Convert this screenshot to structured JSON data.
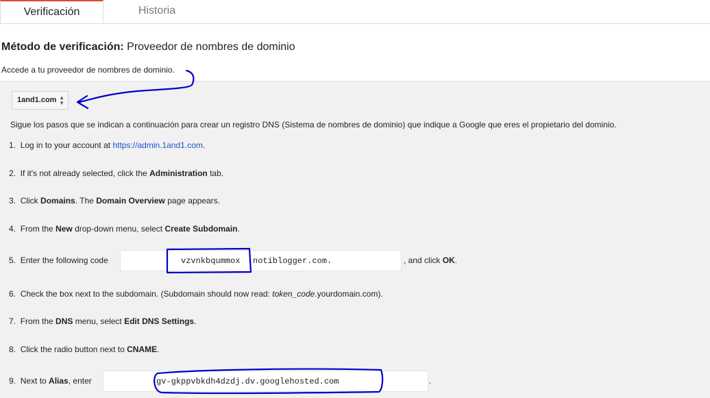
{
  "tabs": [
    {
      "label": "Verificación",
      "active": true
    },
    {
      "label": "Historia",
      "active": false
    }
  ],
  "method": {
    "label": "Método de verificación:",
    "value": "Proveedor de nombres de dominio"
  },
  "access_text": "Accede a tu proveedor de nombres de dominio.",
  "provider_select": {
    "value": "1and1.com"
  },
  "intro": "Sigue los pasos que se indican a continuación para crear un registro DNS (Sistema de nombres de dominio) que indique a Google que eres el propietario del dominio.",
  "steps": {
    "s1": {
      "num": "1.",
      "pre": "Log in to your account at ",
      "link": "https://admin.1and1.com",
      "post": "."
    },
    "s2": {
      "num": "2.",
      "pre": "If it's not already selected, click the ",
      "bold": "Administration",
      "post": " tab."
    },
    "s3": {
      "num": "3.",
      "pre": "Click ",
      "bold1": "Domains",
      "mid": ". The ",
      "bold2": "Domain Overview",
      "post": " page appears."
    },
    "s4": {
      "num": "4.",
      "pre": "From the ",
      "bold1": "New",
      "mid": " drop-down menu, select ",
      "bold2": "Create Subdomain",
      "post": "."
    },
    "s5": {
      "num": "5.",
      "pre": "Enter the following code",
      "token": "vzvnkbqummox",
      "domain": "notiblogger.com.",
      "post": ", and click ",
      "bold": "OK",
      "end": "."
    },
    "s6": {
      "num": "6.",
      "pre": "Check the box next to the subdomain. (Subdomain should now read: ",
      "italic": "token_code",
      "post": ".yourdomain.com)."
    },
    "s7": {
      "num": "7.",
      "pre": "From the ",
      "bold1": "DNS",
      "mid": " menu, select ",
      "bold2": "Edit DNS Settings",
      "post": "."
    },
    "s8": {
      "num": "8.",
      "pre": "Click the radio button next to ",
      "bold": "CNAME",
      "post": "."
    },
    "s9": {
      "num": "9.",
      "pre": "Next to ",
      "bold": "Alias",
      "mid": ", enter",
      "value": "gv-gkppvbkdh4dzdj.dv.googlehosted.com",
      "post": "."
    }
  },
  "colors": {
    "accent_tab": "#dd4b39",
    "link": "#1a55cc",
    "annotation": "#0000cc",
    "panel": "#f1f1f1"
  }
}
